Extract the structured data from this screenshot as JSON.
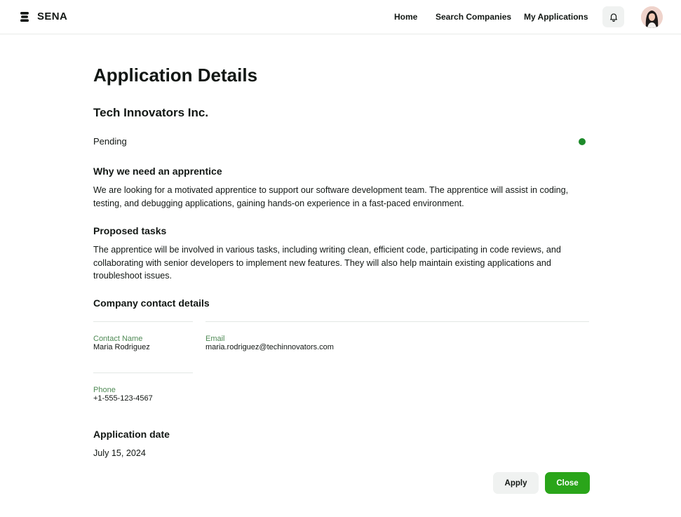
{
  "app": {
    "brand": "SENA",
    "logo_icon": "stacked-layers-icon"
  },
  "nav": {
    "home": "Home",
    "search_companies": "Search Companies",
    "my_applications": "My Applications"
  },
  "header": {
    "notifications_icon": "bell-icon",
    "avatar_icon": "user-avatar"
  },
  "page": {
    "title": "Application Details"
  },
  "application": {
    "company_name": "Tech Innovators Inc.",
    "status": "Pending",
    "status_color": "#1d8a2a",
    "why_heading": "Why we need an apprentice",
    "why_text": "We are looking for a motivated apprentice to support our software development team. The apprentice will assist in coding, testing, and debugging applications, gaining hands-on experience in a fast-paced environment.",
    "tasks_heading": "Proposed tasks",
    "tasks_text": "The apprentice will be involved in various tasks, including writing clean, efficient code, participating in code reviews, and collaborating with senior developers to implement new features. They will also help maintain existing applications and troubleshoot issues.",
    "contact_heading": "Company contact details",
    "contact": {
      "name_label": "Contact Name",
      "name": "Maria Rodriguez",
      "email_label": "Email",
      "email": "maria.rodriguez@techinnovators.com",
      "phone_label": "Phone",
      "phone": "+1-555-123-4567"
    },
    "date_heading": "Application date",
    "date": "July 15, 2024"
  },
  "actions": {
    "apply": "Apply",
    "close": "Close",
    "accent_color": "#2aa51a"
  }
}
